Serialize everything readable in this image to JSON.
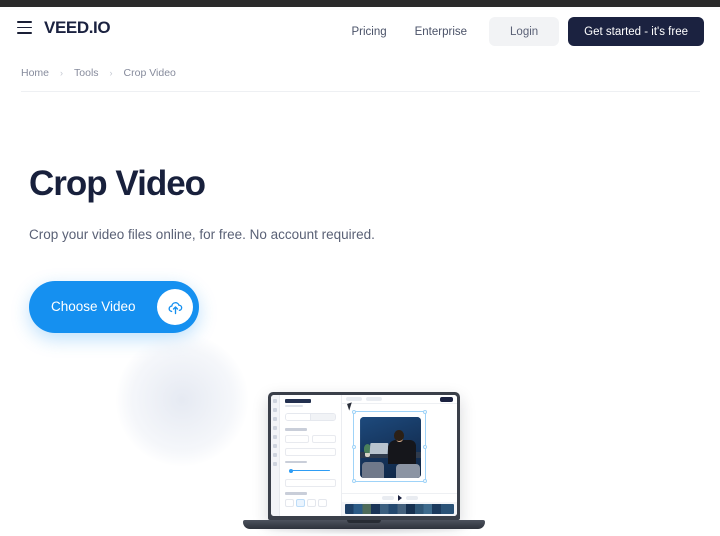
{
  "header": {
    "menu_icon": "hamburger-icon",
    "logo": "VEED.IO",
    "nav_links": [
      {
        "label": "Pricing"
      },
      {
        "label": "Enterprise"
      }
    ],
    "login_label": "Login",
    "get_started_label": "Get started - it's free"
  },
  "breadcrumb": {
    "items": [
      {
        "label": "Home"
      },
      {
        "label": "Tools"
      },
      {
        "label": "Crop Video"
      }
    ],
    "separator": "›"
  },
  "hero": {
    "title": "Crop Video",
    "subtitle": "Crop your video files online, for free. No account required.",
    "cta_label": "Choose Video",
    "cta_icon": "cloud-upload-icon"
  },
  "mockup": {
    "name": "laptop-editor-mockup",
    "alt": "VEED video editor showing a video being cropped on a laptop"
  },
  "colors": {
    "accent_blue": "#1590f0",
    "dark_navy": "#1b2240",
    "text_grey": "#5a6176",
    "light_button": "#f2f3f5",
    "divider": "#eef0f3"
  }
}
